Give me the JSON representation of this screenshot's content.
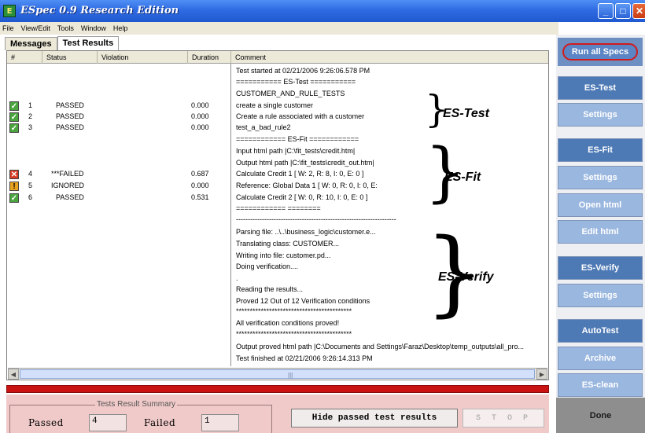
{
  "window": {
    "title": "ESpec 0.9 Research Edition"
  },
  "menu": [
    "File",
    "View/Edit",
    "Tools",
    "Window",
    "Help"
  ],
  "tabs": [
    {
      "label": "Messages",
      "active": false
    },
    {
      "label": "Test Results",
      "active": true
    }
  ],
  "table": {
    "headers": {
      "num": "#",
      "status": "Status",
      "violation": "Violation",
      "duration": "Duration",
      "comment": "Comment"
    },
    "rows": [
      {
        "num": "1",
        "status": "PASSED",
        "duration": "0.000",
        "icon": "check-icon"
      },
      {
        "num": "2",
        "status": "PASSED",
        "duration": "0.000",
        "icon": "check-icon"
      },
      {
        "num": "3",
        "status": "PASSED",
        "duration": "0.000",
        "icon": "check-icon"
      },
      {
        "num": "4",
        "status": "***FAILED",
        "duration": "0.687",
        "icon": "x-icon"
      },
      {
        "num": "5",
        "status": "IGNORED",
        "duration": "0.000",
        "icon": "warning-icon"
      },
      {
        "num": "6",
        "status": "PASSED",
        "duration": "0.531",
        "icon": "check-icon"
      }
    ],
    "comments": [
      "Test started at 02/21/2006 9:26:06.578 PM",
      "=========== ES-Test ===========",
      "CUSTOMER_AND_RULE_TESTS",
      "create a single customer",
      "Create a rule associated with a customer",
      "test_a_bad_rule2",
      "============ ES-Fit ============",
      "Input html path |C:\\fit_tests\\credit.htm|",
      "Output html path |C:\\fit_tests\\credit_out.htm|",
      "Calculate Credit 1    [ W: 2, R: 8, I: 0, E: 0 ]",
      " Reference: Global Data 1    [ W: 0, R: 0, I: 0, E:",
      "Calculate Credit 2    [ W: 0, R: 10, I: 0, E: 0 ]",
      "============               ========",
      "--------------------------------------------------------------------",
      "Parsing file: ..\\..\\business_logic\\customer.e...",
      " Translating class: CUSTOMER...",
      " Writing into file: customer.pd...",
      "Doing verification....",
      ".",
      "Reading the results...",
      "Proved 12 Out of 12 Verification conditions",
      "******************************************",
      "All verification conditions proved!",
      "******************************************",
      "Output proved html path |C:\\Documents and Settings\\Faraz\\Desktop\\temp_outputs\\all_pro...",
      "Test finished at 02/21/2006 9:26:14.313 PM"
    ]
  },
  "annotations": {
    "es_test": "ES-Test",
    "es_fit": "ES-Fit",
    "es_verify": "ES-Verify"
  },
  "summary": {
    "title": "Tests Result Summary",
    "passed_label": "Passed",
    "passed_value": "4",
    "failed_label": "Failed",
    "failed_value": "1"
  },
  "buttons": {
    "hide_passed": "Hide passed test results",
    "stop": "S T O P"
  },
  "sidebar": {
    "run_all": "Run all Specs",
    "es_test": "ES-Test",
    "settings_1": "Settings",
    "es_fit": "ES-Fit",
    "settings_2": "Settings",
    "open_html": "Open html",
    "edit_html": "Edit html",
    "es_verify": "ES-Verify",
    "settings_3": "Settings",
    "autotest": "AutoTest",
    "archive": "Archive",
    "es_clean": "ES-clean",
    "done": "Done"
  },
  "colors": {
    "title_bar": "#2f6be3",
    "fail_bar": "#ca1414",
    "summary_bg": "#f0c9c9",
    "sidebar_dark": "#4d79b5",
    "sidebar_light": "#9ab7df"
  }
}
